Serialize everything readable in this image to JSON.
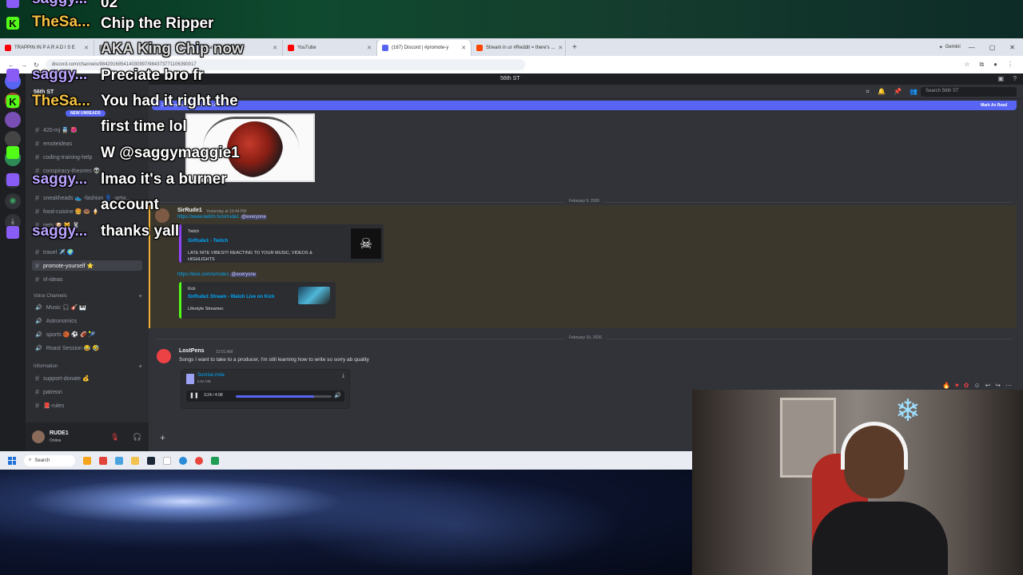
{
  "browser": {
    "tabs": [
      {
        "label": "TRAPPIN IN P A R A D I S E",
        "color": "#ff0000",
        "active": false
      },
      {
        "label": "",
        "color": "#888888",
        "active": false
      },
      {
        "label": "board",
        "color": "#5a8dee",
        "active": false
      },
      {
        "label": "YouTube",
        "color": "#ff0000",
        "active": false
      },
      {
        "label": "(167) Discord | #promote-y",
        "color": "#5865f2",
        "active": true
      },
      {
        "label": "Stream in ur #Reddit = there's ...",
        "color": "#ff4500",
        "active": false
      }
    ],
    "new_tab": "+",
    "gemini_label": "Gemini",
    "url": "discord.com/channels/984291685414030997/984373771106390017"
  },
  "discord": {
    "server_name": "56th ST",
    "topbar_title": "56th ST",
    "new_unreads": "NEW UNREADS",
    "channels": [
      {
        "label": "420-mj 🚆 🌺",
        "active": false
      },
      {
        "label": "emoteideas",
        "active": false
      },
      {
        "label": "coding-training-help",
        "active": false
      },
      {
        "label": "conspiracy-theories 👽",
        "active": false
      },
      {
        "label": "sneakheads 👟 -fashion 👖 -artw...",
        "active": false
      },
      {
        "label": "food-cuisine 🍔 🍩 🍦",
        "active": false
      },
      {
        "label": "pets 🐶 🐱 🐰",
        "active": false
      },
      {
        "label": "travel ✈️ 🌍",
        "active": false
      },
      {
        "label": "promote-yourself ⭐",
        "active": true
      },
      {
        "label": "irl-ideas",
        "active": false
      }
    ],
    "voice_category": "Voice Channels",
    "voice_channels": [
      "Music 🎧 🎸 🎹",
      "Astronomics",
      "sports 🏀 ⚽ 🏈 🎾",
      "Roast Session 😂 🤣"
    ],
    "info_category": "Information",
    "info_channels": [
      "support-donate 💰",
      "patreon",
      "📕-rules"
    ],
    "user": {
      "name": "RUDE1",
      "status": "Online"
    },
    "search_placeholder": "Search 56th ST",
    "new_messages_banner": "2 new messages since 12:06 AM",
    "mark_as_read": "Mark As Read",
    "dates": [
      "February 9, 2026",
      "February 10, 2026"
    ],
    "messages": [
      {
        "author": "SirRude1",
        "timestamp": "Yesterday at 10:44 PM",
        "link1": "https://www.twitch.tv/sirrude1",
        "mention": "@everyone",
        "embed1": {
          "provider": "Twitch",
          "title": "SirRude1 - Twitch",
          "desc": "LATE NITE VIBES!!!! REACTING TO YOUR MUSIC, VIDEOS & HIGHLIGHTS"
        },
        "link2": "https://kick.com/sirrude1",
        "embed2": {
          "provider": "Kick",
          "title": "SirRude1 Stream - Watch Live on Kick",
          "desc": "Lifestyle Streamer."
        }
      },
      {
        "author": "LostPens",
        "timestamp": "12:01 AM",
        "text": "Songs I want to take to a producer, I'm still learning how to write so sorry ab quality",
        "attachment": {
          "name": "Sunrise.m4a",
          "size": "5.84 MB",
          "time": "3:24 / 4:08",
          "progress": 0.82
        }
      }
    ]
  },
  "taskbar": {
    "search_label": "Search"
  },
  "overlay": {
    "messages": [
      {
        "user": "saggy...",
        "text": "02",
        "color": "#b9a3ff",
        "badge": "#8a5cf6",
        "badge_text": ""
      },
      {
        "user": "TheSa...",
        "text": "Chip the Ripper",
        "color": "#f5c243",
        "badge": "#53fc18",
        "badge_text": "K"
      },
      {
        "user": "",
        "text": "AKA King Chip now",
        "color": "#ffffff",
        "badge": "",
        "badge_text": ""
      },
      {
        "user": "saggy...",
        "text": "Preciate bro fr",
        "color": "#b9a3ff",
        "badge": "#8a5cf6",
        "badge_text": ""
      },
      {
        "user": "TheSa...",
        "text": "You had it right the first time lol",
        "color": "#f5c243",
        "badge": "#53fc18",
        "badge_text": "K"
      },
      {
        "user": "",
        "text": "W @saggymaggie1",
        "color": "#ffffff",
        "badge": "#53fc18",
        "badge_text": ""
      },
      {
        "user": "saggy...",
        "text": "lmao it's a burner account",
        "color": "#b9a3ff",
        "badge": "#8a5cf6",
        "badge_text": ""
      },
      {
        "user": "saggy...",
        "text": "thanks yall",
        "color": "#b9a3ff",
        "badge": "#8a5cf6",
        "badge_text": ""
      }
    ]
  }
}
